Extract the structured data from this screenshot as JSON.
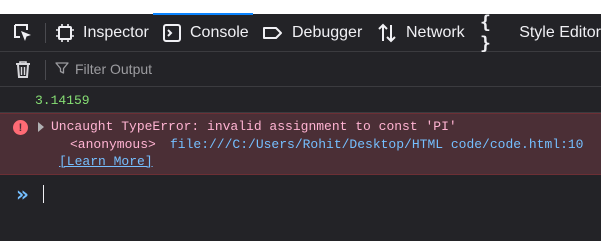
{
  "toolbar": {
    "tabs": [
      {
        "label": "Inspector",
        "icon": "inspector-icon"
      },
      {
        "label": "Console",
        "icon": "console-icon",
        "active": true
      },
      {
        "label": "Debugger",
        "icon": "debugger-icon"
      },
      {
        "label": "Network",
        "icon": "network-icon"
      },
      {
        "label": "Style Editor",
        "icon": "style-editor-icon"
      }
    ]
  },
  "filter": {
    "placeholder": "Filter Output"
  },
  "console": {
    "log_value": "3.14159",
    "error": {
      "message": "Uncaught TypeError: invalid assignment to const 'PI'",
      "frame": "<anonymous>",
      "location": "file:///C:/Users/Rohit/Desktop/HTML code/code.html:10",
      "learn_more": "[Learn More]"
    }
  },
  "colors": {
    "background": "#232327",
    "accent": "#0a84ff",
    "log_text": "#86de74",
    "error_background": "#4b2f36",
    "error_text": "#ffb3d2",
    "link": "#75bfff"
  }
}
